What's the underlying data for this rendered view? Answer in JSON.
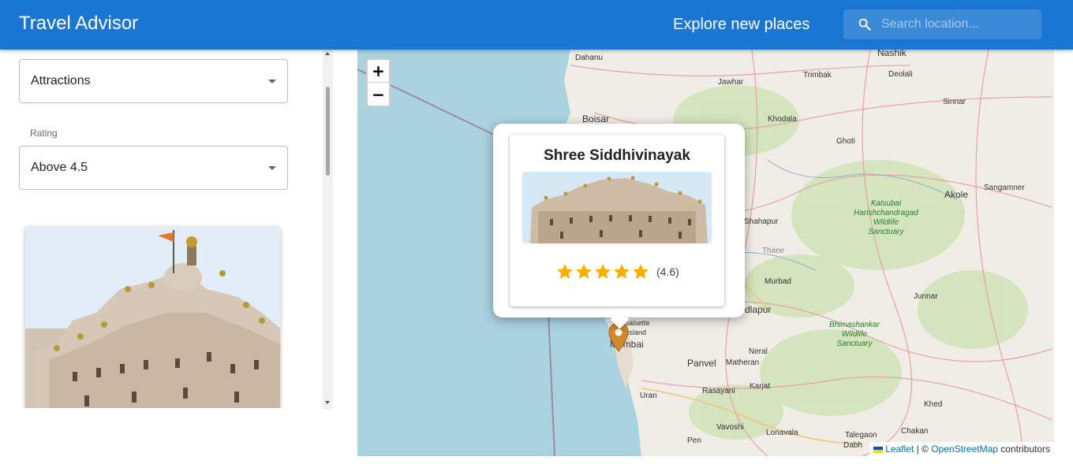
{
  "header": {
    "title": "Travel Advisor",
    "explore": "Explore new places",
    "search_placeholder": "Search location..."
  },
  "filters": {
    "type_value": "Attractions",
    "rating_label": "Rating",
    "rating_value": "Above 4.5"
  },
  "map": {
    "zoom_in": "+",
    "zoom_out": "−",
    "labels": {
      "dahanu": "Dahanu",
      "nashik": "Nashik",
      "jawhar": "Jawhar",
      "trimbak": "Trimbak",
      "deolali": "Deolali",
      "sinnar": "Sinnar",
      "boisar": "Boisar",
      "khodala": "Khodala",
      "ghoti": "Ghoti",
      "akole": "Akole",
      "sangamner": "Sangamner",
      "shahapur": "Shahapur",
      "thane": "Thane",
      "murbad": "Murbad",
      "badlapur": "dlapur",
      "junnar": "Junnar",
      "salsette": "Salsette",
      "island": "Island",
      "mumbai": "Mumbai",
      "panvel": "Panvel",
      "matheran": "Matheran",
      "neral": "Neral",
      "uran": "Uran",
      "rasayani": "Rasayani",
      "karjat": "Karjat",
      "khed": "Khed",
      "vavoshi": "Vavoshi",
      "lonavala": "Lonavala",
      "talegaon": "Talegaon",
      "chakan": "Chakan",
      "pen": "Pen",
      "dabh": "Dabh",
      "kalsubai": "Kalsubai",
      "harishchandragad": "Harishchandragad",
      "wildlife": "Wildlife",
      "sanctuary": "Sanctuary",
      "bhimashankar": "Bhimashankar",
      "wildlife2": "Wildlife",
      "sanctuary2": "Sanctuary"
    },
    "attribution": {
      "leaflet": "Leaflet",
      "sep": "| ©",
      "osm": "OpenStreetMap",
      "contributors": "contributors"
    }
  },
  "popup": {
    "title": "Shree Siddhivinayak",
    "rating": 4.6,
    "rating_text": "(4.6)",
    "star_color": "#faaf00"
  },
  "colors": {
    "appbar": "#1976d2",
    "water": "#aad3df",
    "marker": "#d18b2c"
  }
}
